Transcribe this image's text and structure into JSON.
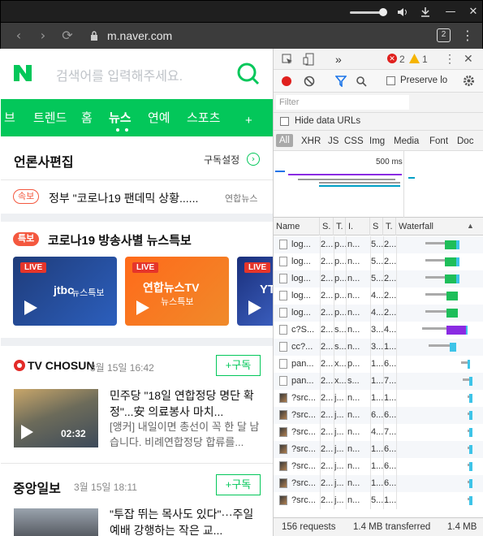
{
  "window": {
    "minimize": "—",
    "restore": "❐",
    "close": "✕"
  },
  "browser": {
    "url": "m.naver.com",
    "tab_count": "2",
    "menu": "⋮",
    "back": "‹",
    "forward": "›",
    "reload": "⟳"
  },
  "naver": {
    "logo": "N",
    "search_placeholder": "검색어를 입력해주세요.",
    "tabs": [
      "브",
      "트렌드",
      "홈",
      "뉴스",
      "연예",
      "스포츠"
    ],
    "active_tab": "뉴스",
    "plus": "+",
    "section_title": "언론사편집",
    "subscribe_settings": "구독설정",
    "breaking_badge": "속보",
    "breaking_headline": "정부 \"코로나19 팬데믹 상황......",
    "breaking_source": "연합뉴스",
    "special_badge": "특보",
    "special_title": "코로나19 방송사별 뉴스특보",
    "cards": [
      {
        "live": "LIVE",
        "brand": "jtbc",
        "sub": "뉴스특보"
      },
      {
        "live": "LIVE",
        "brand": "연합뉴스TV",
        "sub": "뉴스특보"
      },
      {
        "live": "LIVE",
        "brand": "YT",
        "sub": ""
      }
    ],
    "articles": [
      {
        "press": "TV CHOSUN",
        "date": "3월 15일 16:42",
        "follow": "+구독",
        "title": "민주당 \"18일 연합정당 명단 확정\"...安 의료봉사 마치...",
        "desc": "[앵커] 내일이면 총선이 꼭 한 달 남습니다. 비례연합정당 합류를...",
        "duration": "02:32"
      },
      {
        "press": "중앙일보",
        "date": "3월 15일 18:11",
        "follow": "+구독",
        "title": "\"투잡 뛰는 목사도 있다\"···주일예배 강행하는 작은 교...",
        "desc": ""
      }
    ]
  },
  "devtools": {
    "errors": "2",
    "warnings": "1",
    "tabs_more": "»",
    "preserve_log": "Preserve lo",
    "filter_placeholder": "Filter",
    "hide_data_urls": "Hide data URLs",
    "types": [
      "All",
      "XHR",
      "JS",
      "CSS",
      "Img",
      "Media",
      "Font",
      "Doc"
    ],
    "overview_label": "500 ms",
    "columns": [
      "Name",
      "S.",
      "T.",
      "I.",
      "S",
      "T.",
      "Waterfall"
    ],
    "requests": [
      {
        "name": "log...",
        "s": "2...",
        "t": "p...",
        "i": "n...",
        "size": "5...",
        "time": "2..."
      },
      {
        "name": "log...",
        "s": "2...",
        "t": "p...",
        "i": "n...",
        "size": "5...",
        "time": "2..."
      },
      {
        "name": "log...",
        "s": "2...",
        "t": "p...",
        "i": "n...",
        "size": "5...",
        "time": "2..."
      },
      {
        "name": "log...",
        "s": "2...",
        "t": "p...",
        "i": "n...",
        "size": "4...",
        "time": "2..."
      },
      {
        "name": "log...",
        "s": "2...",
        "t": "p...",
        "i": "n...",
        "size": "4...",
        "time": "2..."
      },
      {
        "name": "c?S...",
        "s": "2...",
        "t": "s...",
        "i": "n...",
        "size": "3...",
        "time": "4..."
      },
      {
        "name": "cc?...",
        "s": "2...",
        "t": "s...",
        "i": "n...",
        "size": "3...",
        "time": "1..."
      },
      {
        "name": "pan...",
        "s": "2...",
        "t": "x...",
        "i": "p...",
        "size": "1...",
        "time": "6..."
      },
      {
        "name": "pan...",
        "s": "2...",
        "t": "x...",
        "i": "s...",
        "size": "1...",
        "time": "7..."
      },
      {
        "name": "?src...",
        "s": "2...",
        "t": "j...",
        "i": "n...",
        "size": "1...",
        "time": "1..."
      },
      {
        "name": "?src...",
        "s": "2...",
        "t": "j...",
        "i": "n...",
        "size": "6...",
        "time": "6..."
      },
      {
        "name": "?src...",
        "s": "2...",
        "t": "j...",
        "i": "n...",
        "size": "4...",
        "time": "7..."
      },
      {
        "name": "?src...",
        "s": "2...",
        "t": "j...",
        "i": "n...",
        "size": "1...",
        "time": "6..."
      },
      {
        "name": "?src...",
        "s": "2...",
        "t": "j...",
        "i": "n...",
        "size": "1...",
        "time": "6..."
      },
      {
        "name": "?src...",
        "s": "2...",
        "t": "j...",
        "i": "n...",
        "size": "1...",
        "time": "6..."
      },
      {
        "name": "?src...",
        "s": "2...",
        "t": "j...",
        "i": "n...",
        "size": "5...",
        "time": "1..."
      }
    ],
    "status_requests": "156 requests",
    "status_transferred": "1.4 MB transferred",
    "status_resources": "1.4 MB"
  },
  "colors": {
    "naver_green": "#03c75a",
    "accent_red": "#f4583f",
    "devtools_bg": "#f3f3f3"
  }
}
